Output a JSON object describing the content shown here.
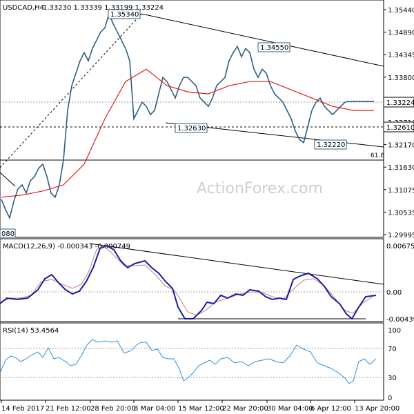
{
  "chart_data": {
    "type": "line",
    "header": {
      "symbol": "USDCAD,H4",
      "ohlc": "1.33230 1.33339 1.33199 1.33224"
    },
    "watermark": "ActionForex.com",
    "price_axis": {
      "ticks": [
        "1.35440",
        "1.34890",
        "1.34345",
        "1.33800",
        "1.33255",
        "1.32710",
        "1.32170",
        "1.31630",
        "1.31075",
        "1.30535",
        "1.29995"
      ],
      "current": "1.33224",
      "marked": "1.32610"
    },
    "x_axis": {
      "labels": [
        "14 Feb 2017",
        "21 Feb 12:00",
        "28 Feb 20:00",
        "8 Mar 04:00",
        "15 Mar 12:00",
        "22 Mar 20:00",
        "30 Mar 04:00",
        "6 Apr 12:00",
        "13 Apr 20:00"
      ]
    },
    "annotations": {
      "high_1": "1.35340",
      "high_2": "1.34550",
      "low_1": "1.32630",
      "low_2": "1.32220",
      "left_low": "080",
      "fib_label": "61.8"
    },
    "series": [
      {
        "name": "USDCAD",
        "x": [
          0,
          2,
          4,
          6,
          8,
          10,
          12,
          14,
          16,
          18,
          20,
          22,
          24,
          26,
          28,
          30,
          32,
          34,
          36,
          38,
          40,
          42,
          44,
          46,
          48,
          50,
          52,
          54,
          56,
          58,
          60,
          62,
          64,
          66,
          68,
          70,
          72,
          74,
          76,
          78,
          80,
          82,
          84,
          86,
          88,
          90,
          92,
          94,
          96,
          98,
          100,
          102,
          104,
          106,
          108,
          110,
          112,
          114,
          116,
          118,
          120,
          122,
          124,
          126,
          128,
          130,
          132,
          134,
          136,
          138,
          140,
          142,
          144,
          146,
          148,
          150,
          152,
          154,
          156,
          158,
          160,
          162,
          164,
          166,
          168,
          170,
          172,
          174,
          176,
          178,
          180
        ],
        "values": [
          1.3085,
          1.306,
          1.304,
          1.308,
          1.311,
          1.312,
          1.31,
          1.313,
          1.314,
          1.316,
          1.317,
          1.314,
          1.31,
          1.309,
          1.312,
          1.318,
          1.33,
          1.336,
          1.339,
          1.342,
          1.344,
          1.342,
          1.345,
          1.347,
          1.349,
          1.35,
          1.3534,
          1.351,
          1.349,
          1.347,
          1.345,
          1.342,
          1.328,
          1.33,
          1.332,
          1.331,
          1.329,
          1.33,
          1.334,
          1.338,
          1.337,
          1.335,
          1.333,
          1.336,
          1.338,
          1.338,
          1.337,
          1.336,
          1.333,
          1.332,
          1.331,
          1.333,
          1.336,
          1.337,
          1.338,
          1.342,
          1.344,
          1.3455,
          1.343,
          1.345,
          1.344,
          1.34,
          1.338,
          1.34,
          1.339,
          1.336,
          1.334,
          1.333,
          1.332,
          1.33,
          1.328,
          1.325,
          1.323,
          1.3222,
          1.326,
          1.33,
          1.332,
          1.333,
          1.331,
          1.33,
          1.329,
          1.33,
          1.331,
          1.332,
          1.3322,
          1.3322,
          1.3322,
          1.3322,
          1.3322,
          1.3322,
          1.3322
        ]
      },
      {
        "name": "MA",
        "x": [
          0,
          10,
          20,
          30,
          40,
          50,
          60,
          70,
          80,
          90,
          100,
          110,
          120,
          130,
          140,
          150,
          160,
          170,
          180
        ],
        "values": [
          1.309,
          1.3095,
          1.3105,
          1.312,
          1.317,
          1.328,
          1.337,
          1.34,
          1.336,
          1.3345,
          1.334,
          1.336,
          1.337,
          1.337,
          1.335,
          1.333,
          1.331,
          1.33,
          1.33
        ]
      }
    ],
    "macd": {
      "label": "MACD(12,26,9) -0.000343 -0.000749",
      "ticks": [
        "0.006754",
        "0.00",
        "-0.004399"
      ]
    },
    "rsi": {
      "label": "RSI(14) 53.4564",
      "ticks": [
        "100",
        "70",
        "30",
        "0"
      ]
    },
    "colors": {
      "price": "#2b5f7f",
      "ma": "#e01b1b",
      "macd": "#1a1aa0",
      "signal": "#c08080",
      "rsi": "#2f8fd8"
    }
  }
}
